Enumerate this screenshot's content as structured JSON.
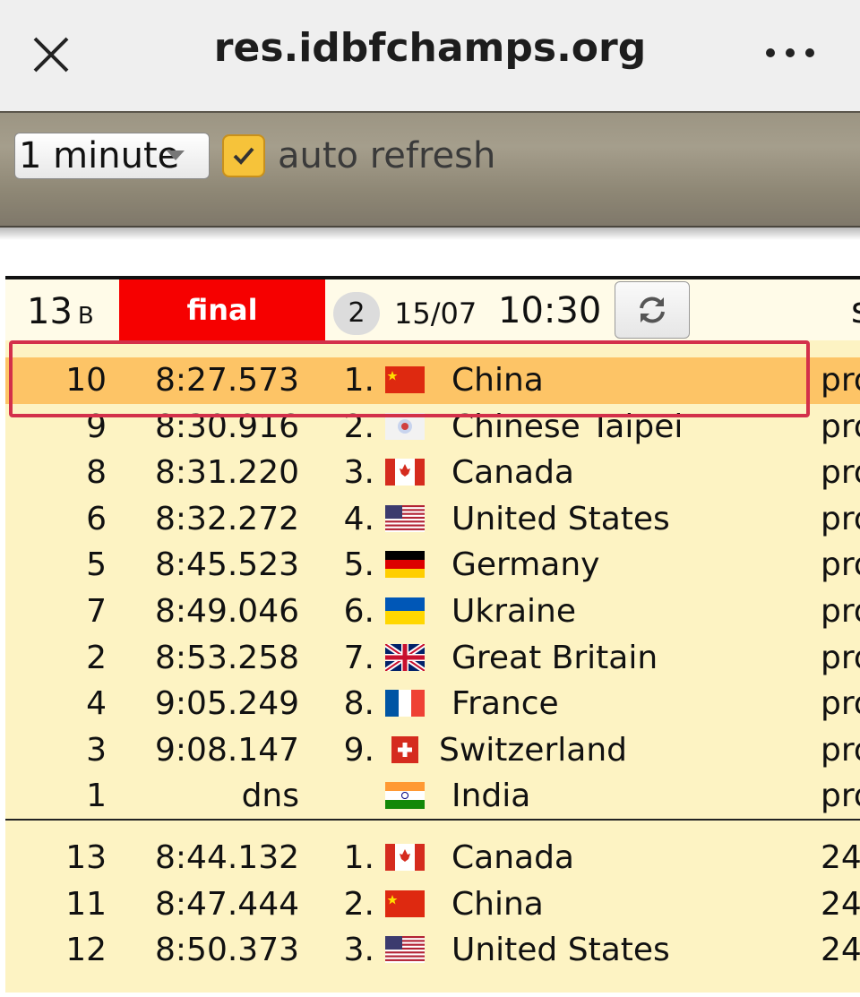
{
  "browser": {
    "url": "res.idbfchamps.org"
  },
  "toolbar": {
    "interval_value": "1 minute",
    "auto_refresh_label": "auto refresh",
    "auto_refresh_checked": true
  },
  "race": {
    "number": "13",
    "category": "B",
    "stage": "final",
    "lane_badge": "2",
    "date": "15/07",
    "time": "10:30",
    "header_clip": "s"
  },
  "results": [
    {
      "lane": "10",
      "time": "8:27.573",
      "rank": "1.",
      "flag": "china",
      "country": "China",
      "status": "pro"
    },
    {
      "lane": "9",
      "time": "8:30.916",
      "rank": "2.",
      "flag": "chinese-taipei",
      "country": "Chinese Taipei",
      "status": "pro"
    },
    {
      "lane": "8",
      "time": "8:31.220",
      "rank": "3.",
      "flag": "canada",
      "country": "Canada",
      "status": "pro"
    },
    {
      "lane": "6",
      "time": "8:32.272",
      "rank": "4.",
      "flag": "united-states",
      "country": "United States",
      "status": "pro"
    },
    {
      "lane": "5",
      "time": "8:45.523",
      "rank": "5.",
      "flag": "germany",
      "country": "Germany",
      "status": "pro"
    },
    {
      "lane": "7",
      "time": "8:49.046",
      "rank": "6.",
      "flag": "ukraine",
      "country": "Ukraine",
      "status": "pro"
    },
    {
      "lane": "2",
      "time": "8:53.258",
      "rank": "7.",
      "flag": "great-britain",
      "country": "Great Britain",
      "status": "pro"
    },
    {
      "lane": "4",
      "time": "9:05.249",
      "rank": "8.",
      "flag": "france",
      "country": "France",
      "status": "pro"
    },
    {
      "lane": "3",
      "time": "9:08.147",
      "rank": "9.",
      "flag": "switzerland",
      "country": "Switzerland",
      "status": "pro"
    },
    {
      "lane": "1",
      "time": "dns",
      "rank": "",
      "flag": "india",
      "country": "India",
      "status": "pro"
    }
  ],
  "next_results": [
    {
      "lane": "13",
      "time": "8:44.132",
      "rank": "1.",
      "flag": "canada",
      "country": "Canada",
      "status": "24"
    },
    {
      "lane": "11",
      "time": "8:47.444",
      "rank": "2.",
      "flag": "china",
      "country": "China",
      "status": "24"
    },
    {
      "lane": "12",
      "time": "8:50.373",
      "rank": "3.",
      "flag": "united-states",
      "country": "United States",
      "status": "24"
    }
  ],
  "colors": {
    "final_bg": "#f60000",
    "row_bg": "#fdf3c3",
    "highlight_bg": "#fdc466",
    "highlight_border": "#d3304a",
    "checkbox": "#f6c33a"
  }
}
